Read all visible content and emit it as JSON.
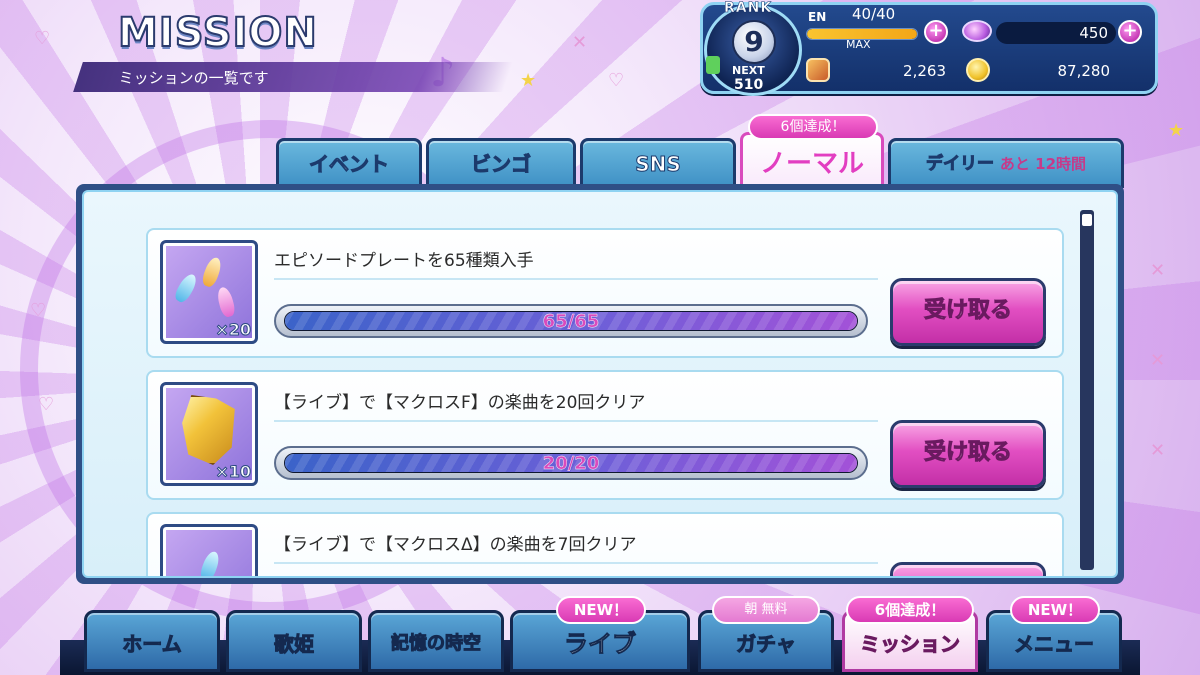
{
  "header": {
    "title": "MISSION",
    "subtitle": "ミッションの一覧です"
  },
  "status": {
    "rank_label": "RANK",
    "rank": "9",
    "next_label": "NEXT",
    "next_value": "510",
    "en_label": "EN",
    "en_value": "40/40",
    "en_fill": 1.0,
    "en_max_label": "MAX",
    "gems": "450",
    "resource_value": "2,263",
    "coins": "87,280"
  },
  "tabs": {
    "items": [
      {
        "label": "イベント"
      },
      {
        "label": "ビンゴ"
      },
      {
        "label": "SNS"
      },
      {
        "label": "ノーマル"
      },
      {
        "label": "デイリー",
        "extra": "あと 12時間"
      }
    ],
    "active_index": 3,
    "active_badge": "6個達成！"
  },
  "missions": [
    {
      "text": "エピソードプレートを65種類入手",
      "icon": "crystal-potions-icon",
      "count": "×20",
      "progress_text": "65/65",
      "progress": 1.0,
      "button_label": "受け取る"
    },
    {
      "text": "【ライブ】で【マクロスF】の楽曲を20回クリア",
      "icon": "gold-crystal-icon",
      "count": "×10",
      "progress_text": "20/20",
      "progress": 1.0,
      "button_label": "受け取る"
    },
    {
      "text": "【ライブ】で【マクロスΔ】の楽曲を7回クリア",
      "icon": "blue-crystal-icon"
    }
  ],
  "nav": {
    "items": [
      {
        "label": "ホーム"
      },
      {
        "label": "歌姫"
      },
      {
        "label": "記憶の時空"
      },
      {
        "label": "ライブ",
        "badge": "NEW！"
      },
      {
        "label": "ガチャ",
        "badge": "朝 無料"
      },
      {
        "label": "ミッション",
        "badge": "6個達成！"
      },
      {
        "label": "メニュー",
        "badge": "NEW！"
      }
    ],
    "active_index": 5
  },
  "colors": {
    "accent_pink": "#e23ec1",
    "panel_blue": "#2f4f86",
    "tab_blue": "#3d8fc4",
    "progress_purple": "#a351d8"
  }
}
